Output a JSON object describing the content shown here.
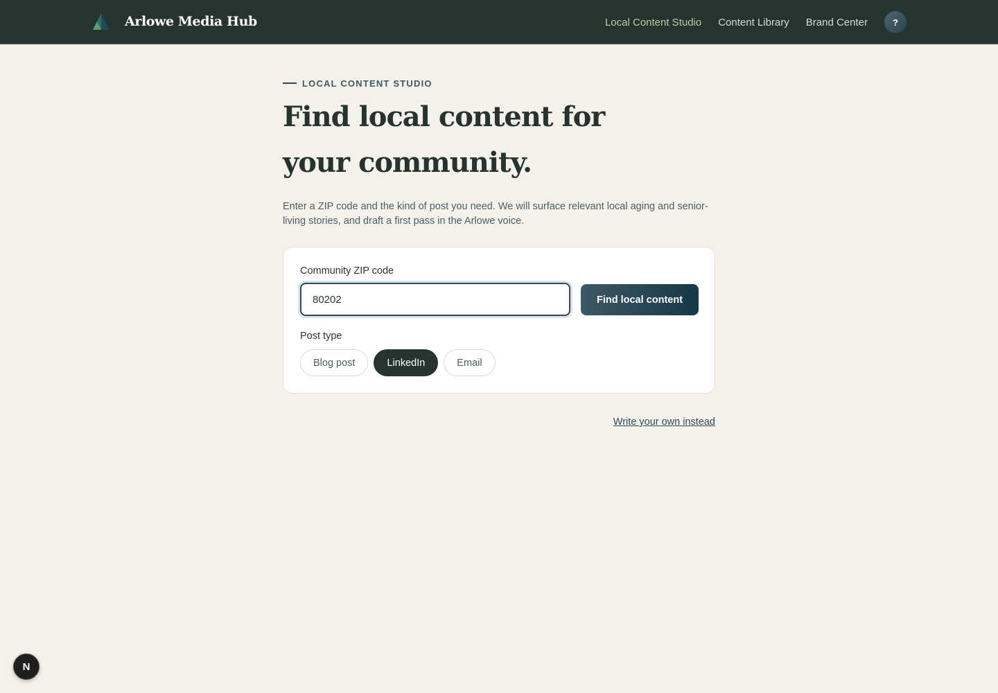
{
  "header": {
    "brand_name": "Arlowe Media Hub",
    "nav": [
      {
        "label": "Local Content Studio",
        "active": true
      },
      {
        "label": "Content Library",
        "active": false
      },
      {
        "label": "Brand Center",
        "active": false
      }
    ],
    "help_label": "?"
  },
  "main": {
    "eyebrow": "LOCAL CONTENT STUDIO",
    "title": "Find local content for your community.",
    "subtitle": "Enter a ZIP code and the kind of post you need. We will surface relevant local aging and senior-living stories, and draft a first pass in the Arlowe voice.",
    "form": {
      "zip_label": "Community ZIP code",
      "zip_value": "80202",
      "find_button": "Find local content",
      "post_type_label": "Post type",
      "post_types": [
        {
          "label": "Blog post",
          "selected": false
        },
        {
          "label": "LinkedIn",
          "selected": true
        },
        {
          "label": "Email",
          "selected": false
        }
      ]
    },
    "write_own_link": "Write your own instead"
  },
  "dev_badge": "N",
  "colors": {
    "header_bg": "#26332f",
    "page_bg": "#f4f1ea",
    "active_nav": "#b7cfa0",
    "accent": "#2f4a57"
  }
}
